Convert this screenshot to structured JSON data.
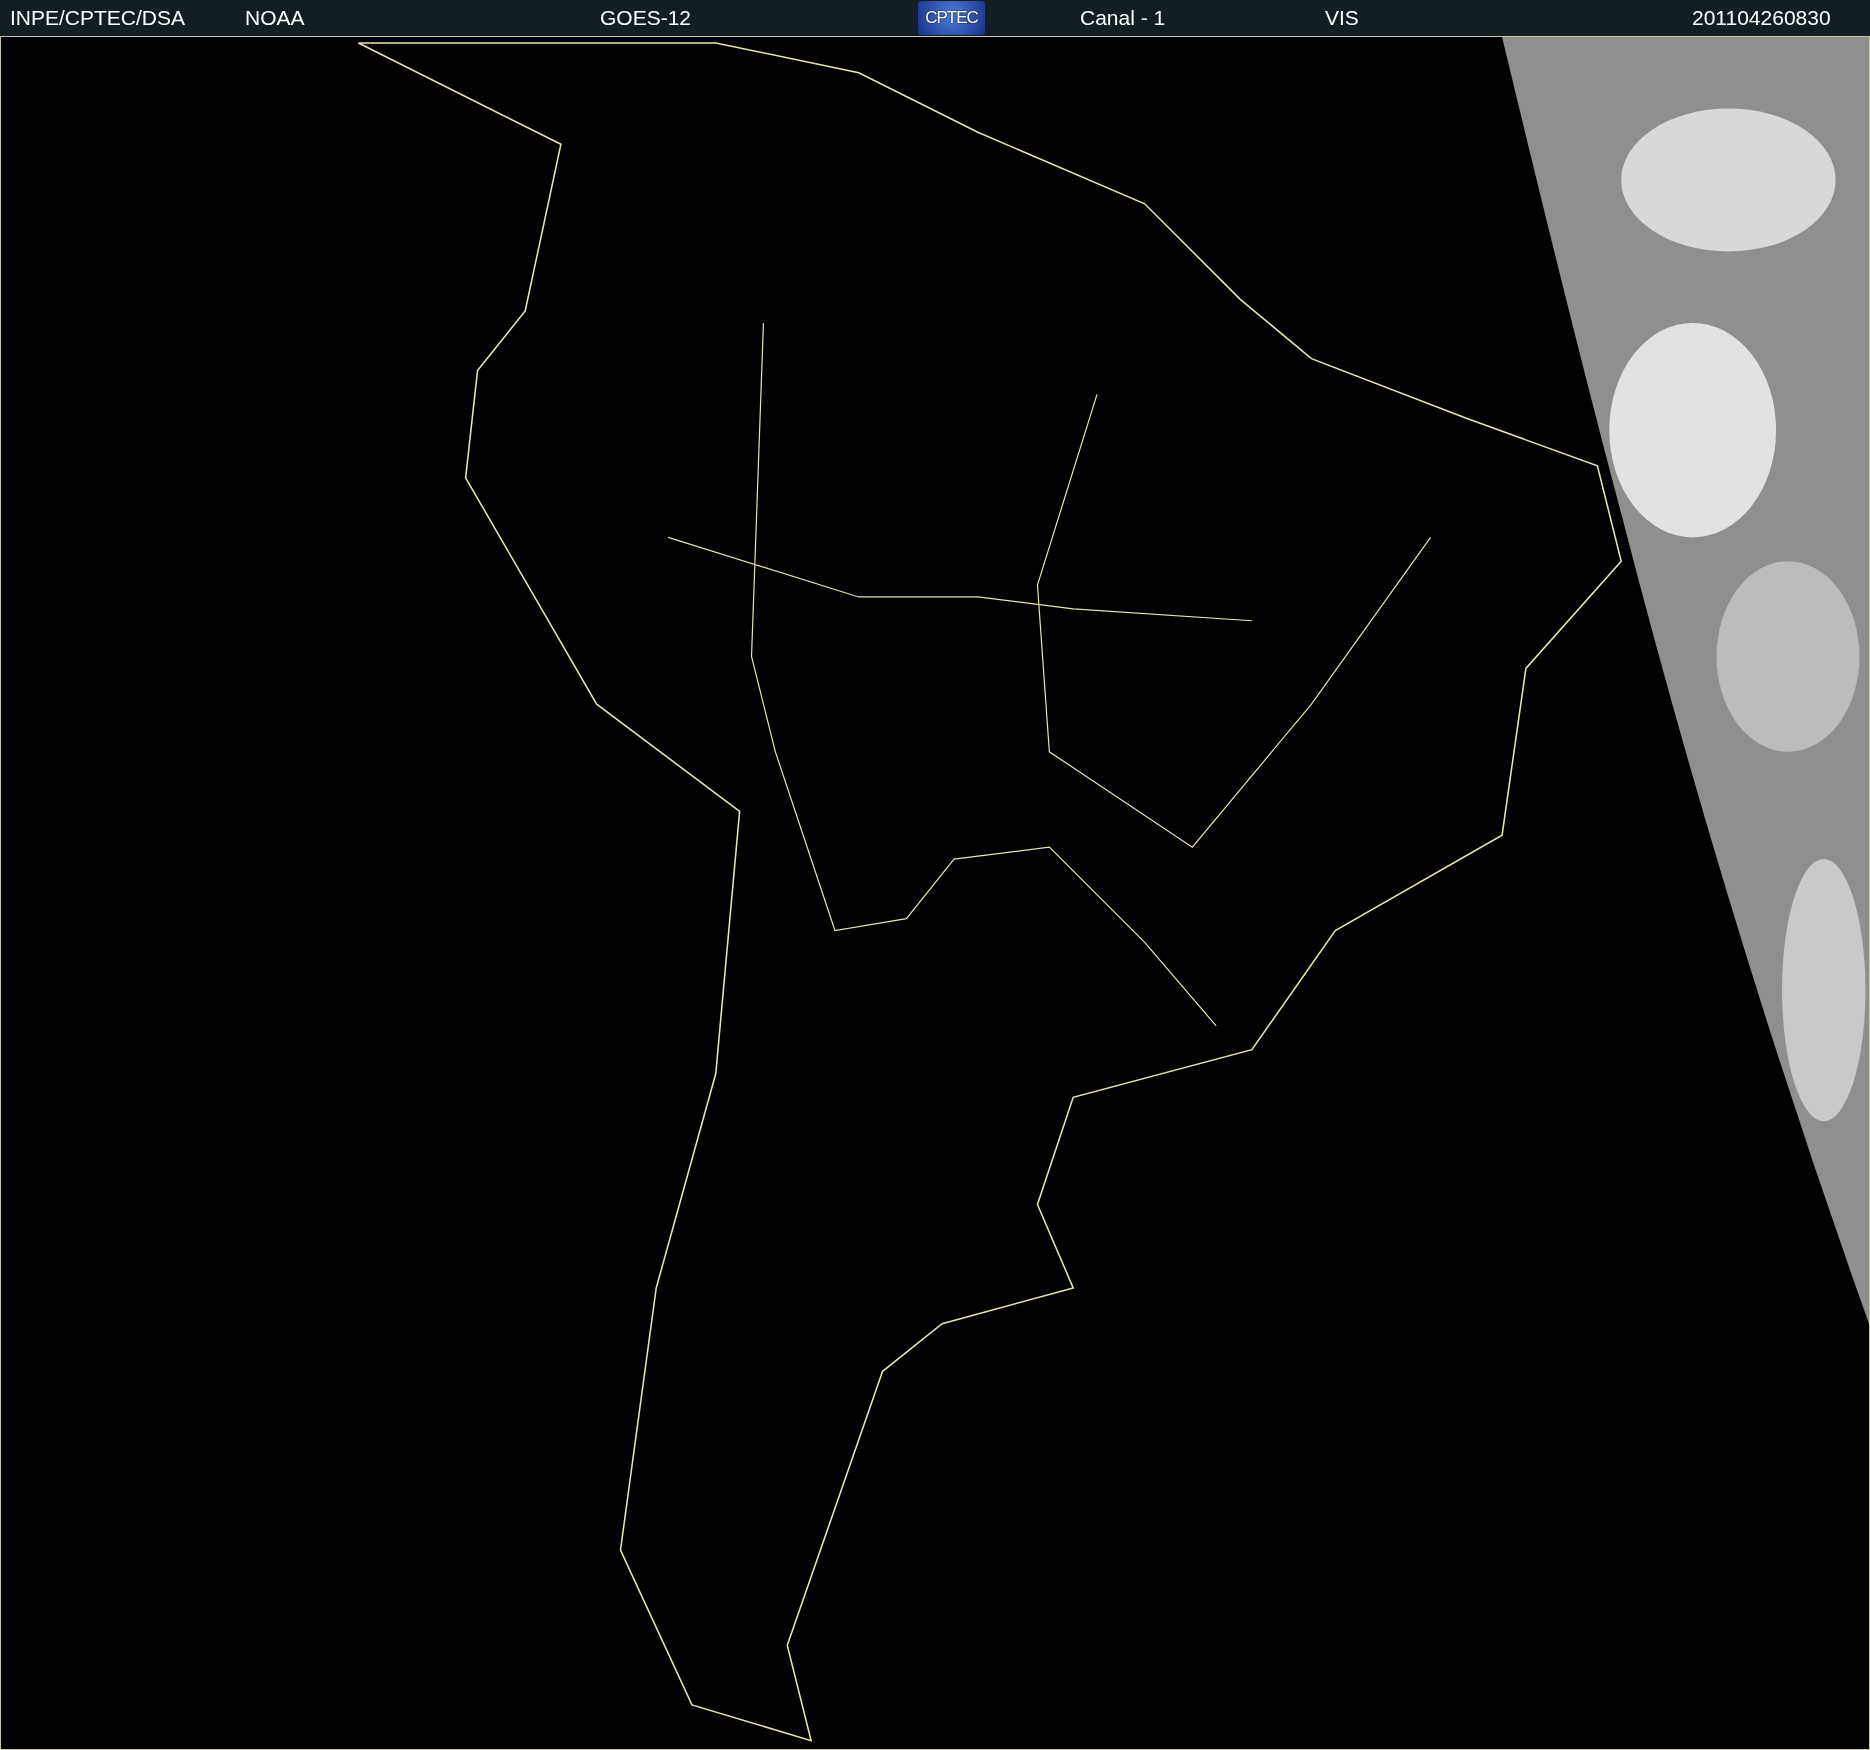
{
  "header": {
    "items": [
      {
        "kind": "text",
        "text": "INPE/CPTEC/DSA"
      },
      {
        "kind": "text",
        "text": "NOAA"
      },
      {
        "kind": "text",
        "text": "GOES-12"
      },
      {
        "kind": "logo",
        "text": "CPTEC"
      },
      {
        "kind": "text",
        "text": "Canal - 1"
      },
      {
        "kind": "text",
        "text": "VIS"
      },
      {
        "kind": "text",
        "text": "201104260830"
      }
    ]
  }
}
